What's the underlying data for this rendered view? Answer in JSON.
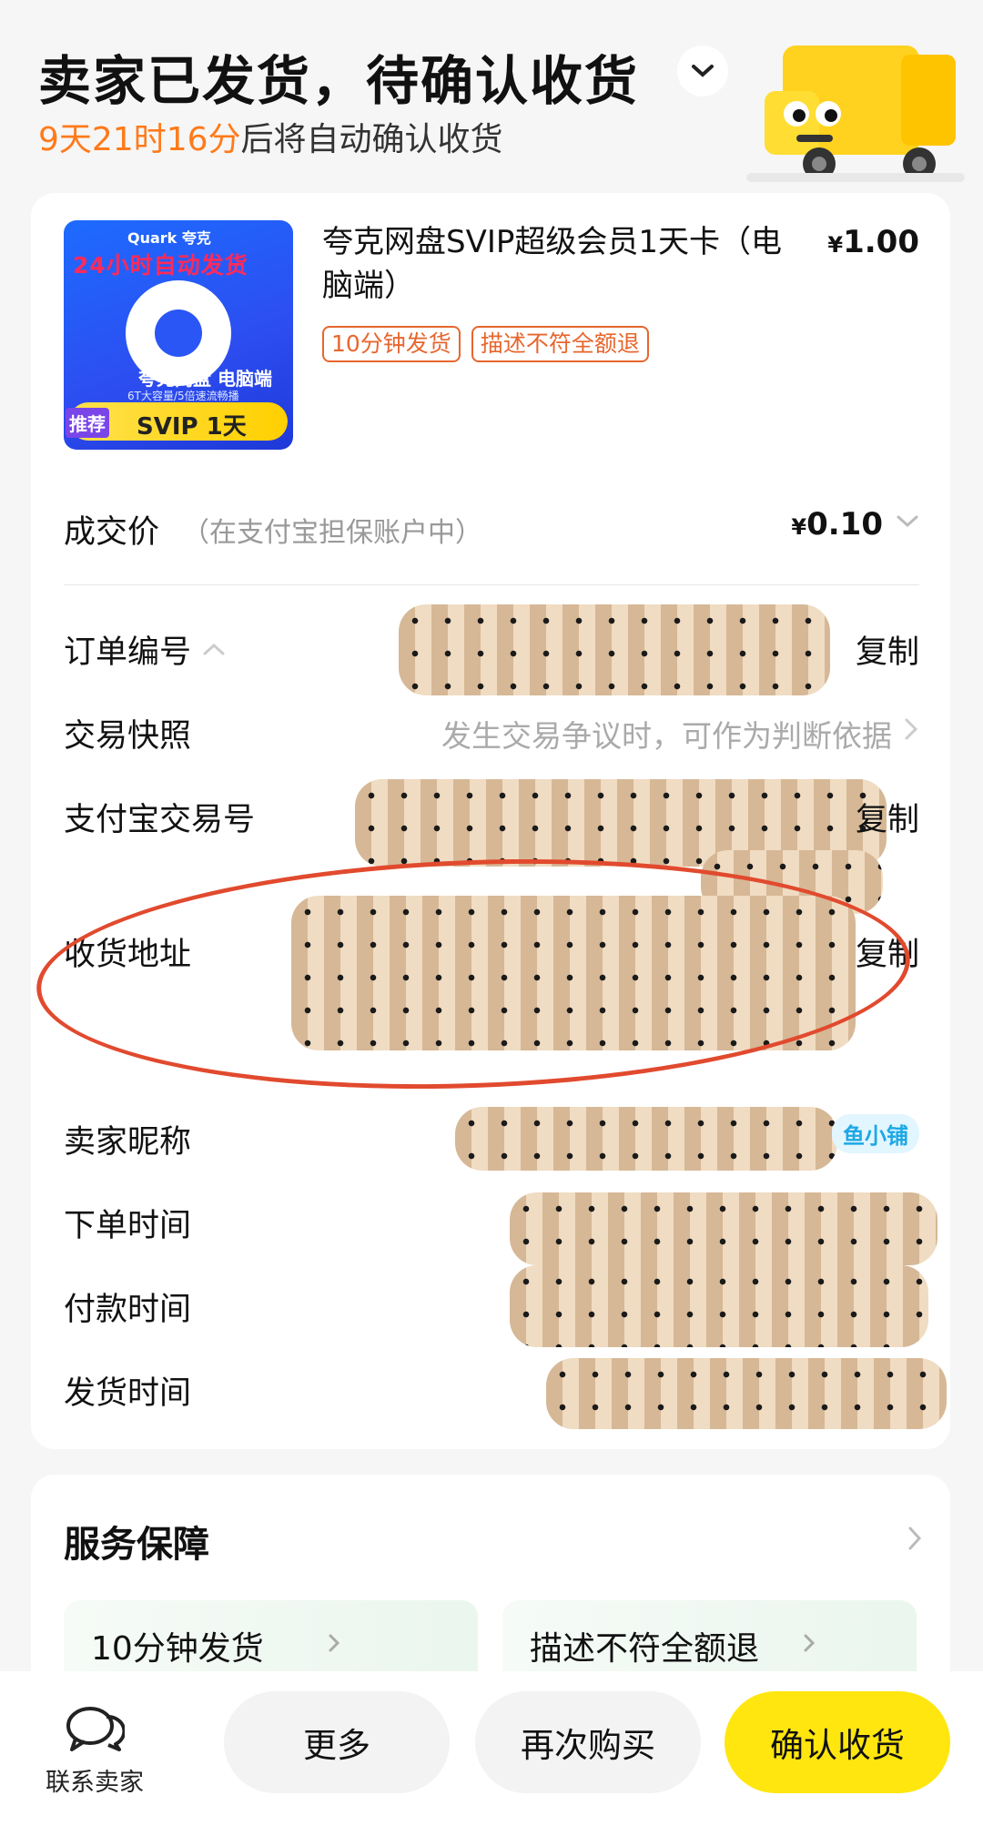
{
  "header": {
    "status_title": "卖家已发货，待确认收货",
    "countdown": "9天21时16分",
    "countdown_suffix": "后将自动确认收货"
  },
  "product": {
    "thumb_brand": "Quark 夸克",
    "thumb_promo": "24小时自动发货",
    "thumb_name": "夸克网盘 电脑端",
    "thumb_sub": "6T大容量/5倍速流畅播",
    "thumb_recommend": "推荐",
    "thumb_svip": "SVIP 1天",
    "title": "夸克网盘SVIP超级会员1天卡（电脑端）",
    "price_symbol": "¥",
    "price": "1.00",
    "tags": [
      "10分钟发货",
      "描述不符全额退"
    ]
  },
  "deal": {
    "label": "成交价",
    "note": "（在支付宝担保账户中）",
    "price_symbol": "¥",
    "price": "0.10"
  },
  "info": {
    "order_no_label": "订单编号",
    "snapshot_label": "交易快照",
    "snapshot_hint": "发生交易争议时，可作为判断依据",
    "alipay_label": "支付宝交易号",
    "address_label": "收货地址",
    "seller_label": "卖家昵称",
    "seller_badge": "鱼小铺",
    "order_time_label": "下单时间",
    "pay_time_label": "付款时间",
    "ship_time_label": "发货时间",
    "copy": "复制"
  },
  "service": {
    "title": "服务保障",
    "items": [
      "10分钟发货",
      "描述不符全额退"
    ]
  },
  "bottom_bar": {
    "contact_label": "联系卖家",
    "more": "更多",
    "buy_again": "再次购买",
    "confirm": "确认收货"
  },
  "colors": {
    "accent_orange": "#ff7a1a",
    "confirm_yellow": "#ffe60f",
    "annotation_red": "#e14a2e"
  }
}
